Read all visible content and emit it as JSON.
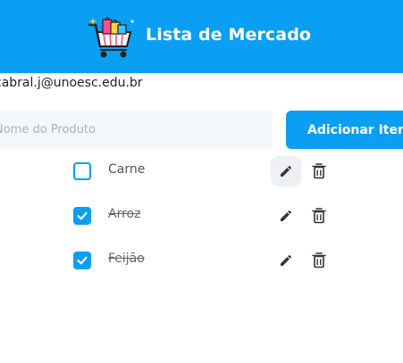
{
  "header": {
    "title": "Lista de Mercado",
    "logo_icon": "shopping-cart-with-bags-icon",
    "background_color": "#0a9ff2"
  },
  "user": {
    "email": "cabral.j@unoesc.edu.br"
  },
  "form": {
    "input_placeholder": "Nome do Produto",
    "input_value": "",
    "add_button_label": "Adicionar Item"
  },
  "items": [
    {
      "label": "Carne",
      "checked": false
    },
    {
      "label": "Arroz",
      "checked": true
    },
    {
      "label": "Feijão",
      "checked": true
    }
  ],
  "icons": {
    "edit": "pencil-icon",
    "delete": "trash-icon",
    "check": "checkmark-icon"
  },
  "colors": {
    "accent": "#0a9ff2",
    "text": "#555555"
  }
}
